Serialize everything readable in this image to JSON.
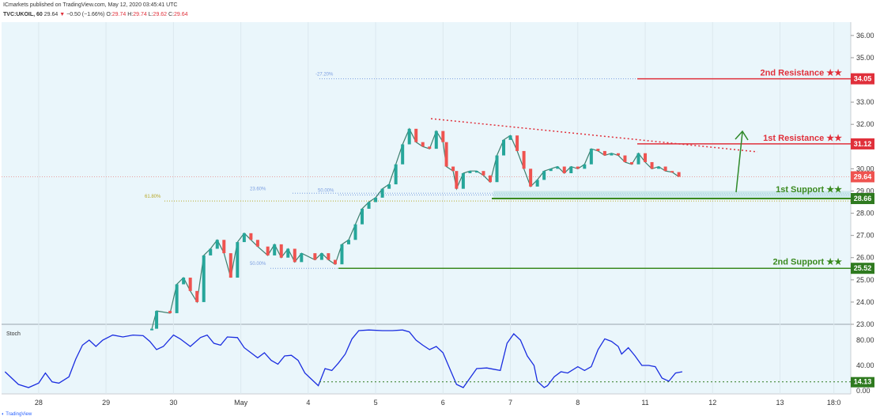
{
  "header": {
    "publisher": "ICmarkets published on TradingView.com, May 12, 2020 03:45:41 UTC",
    "symbol": "TVC:UKOIL, 60",
    "last": "29.64",
    "change": "−0.50 (−1.66%)",
    "ohlc": {
      "O": "29.74",
      "H": "29.74",
      "L": "29.62",
      "C": "29.64"
    }
  },
  "colors": {
    "background": "#eaf6fb",
    "candle_up": "#26a69a",
    "candle_down": "#ef5350",
    "resistance": "#e0303b",
    "support": "#3a8a1f",
    "fib": "#7b9ee0",
    "stoch": "#1a2de0"
  },
  "chart_data": {
    "type": "candlestick",
    "y_axis": {
      "range": [
        23,
        36.6
      ],
      "ticks": [
        "36.00",
        "35.00",
        "34.00",
        "33.00",
        "32.00",
        "31.00",
        "30.00",
        "29.00",
        "28.00",
        "27.00",
        "26.00",
        "25.00",
        "24.00",
        "23.00"
      ]
    },
    "x_axis": {
      "ticks": [
        {
          "label": "28",
          "t": 0.5
        },
        {
          "label": "29",
          "t": 1.5
        },
        {
          "label": "30",
          "t": 2.5
        },
        {
          "label": "May",
          "t": 3.5
        },
        {
          "label": "4",
          "t": 4.5
        },
        {
          "label": "5",
          "t": 5.5
        },
        {
          "label": "6",
          "t": 6.5
        },
        {
          "label": "7",
          "t": 7.5
        },
        {
          "label": "8",
          "t": 8.5
        },
        {
          "label": "11",
          "t": 9.5
        },
        {
          "label": "12",
          "t": 10.5
        },
        {
          "label": "13",
          "t": 11.5
        },
        {
          "label": "18:0",
          "t": 12.3
        }
      ]
    },
    "price_series": [
      [
        2.18,
        22.8
      ],
      [
        2.25,
        23.6
      ],
      [
        2.45,
        23.5
      ],
      [
        2.55,
        24.8
      ],
      [
        2.65,
        25.1
      ],
      [
        2.75,
        24.5
      ],
      [
        2.85,
        24.0
      ],
      [
        2.95,
        26.1
      ],
      [
        3.05,
        26.4
      ],
      [
        3.15,
        26.8
      ],
      [
        3.25,
        26.2
      ],
      [
        3.35,
        25.1
      ],
      [
        3.45,
        26.7
      ],
      [
        3.55,
        27.1
      ],
      [
        3.65,
        26.8
      ],
      [
        3.75,
        26.5
      ],
      [
        3.9,
        26.1
      ],
      [
        4.0,
        26.6
      ],
      [
        4.1,
        26.0
      ],
      [
        4.2,
        26.4
      ],
      [
        4.3,
        25.8
      ],
      [
        4.4,
        26.2
      ],
      [
        4.6,
        25.9
      ],
      [
        4.7,
        26.2
      ],
      [
        4.8,
        25.9
      ],
      [
        4.9,
        25.7
      ],
      [
        5.0,
        26.6
      ],
      [
        5.1,
        26.8
      ],
      [
        5.2,
        27.5
      ],
      [
        5.3,
        28.2
      ],
      [
        5.4,
        28.5
      ],
      [
        5.5,
        28.7
      ],
      [
        5.6,
        29.1
      ],
      [
        5.7,
        29.3
      ],
      [
        5.8,
        30.2
      ],
      [
        5.9,
        31.1
      ],
      [
        6.0,
        31.8
      ],
      [
        6.1,
        31.2
      ],
      [
        6.2,
        31.0
      ],
      [
        6.3,
        30.9
      ],
      [
        6.4,
        31.7
      ],
      [
        6.5,
        31.2
      ],
      [
        6.55,
        30.1
      ],
      [
        6.65,
        29.9
      ],
      [
        6.7,
        29.1
      ],
      [
        6.8,
        29.8
      ],
      [
        6.9,
        29.9
      ],
      [
        7.0,
        29.9
      ],
      [
        7.1,
        29.7
      ],
      [
        7.2,
        29.4
      ],
      [
        7.3,
        30.6
      ],
      [
        7.4,
        31.3
      ],
      [
        7.5,
        31.5
      ],
      [
        7.6,
        30.8
      ],
      [
        7.7,
        30.0
      ],
      [
        7.8,
        29.2
      ],
      [
        7.9,
        29.5
      ],
      [
        8.0,
        29.9
      ],
      [
        8.1,
        30.0
      ],
      [
        8.2,
        30.1
      ],
      [
        8.3,
        29.8
      ],
      [
        8.4,
        30.1
      ],
      [
        8.5,
        30.0
      ],
      [
        8.6,
        30.2
      ],
      [
        8.7,
        30.9
      ],
      [
        8.8,
        30.8
      ],
      [
        8.9,
        30.6
      ],
      [
        9.0,
        30.7
      ],
      [
        9.1,
        30.6
      ],
      [
        9.2,
        30.3
      ],
      [
        9.3,
        30.2
      ],
      [
        9.4,
        30.7
      ],
      [
        9.5,
        30.3
      ],
      [
        9.6,
        30.0
      ],
      [
        9.7,
        30.1
      ],
      [
        9.8,
        29.9
      ],
      [
        9.9,
        29.85
      ],
      [
        10.0,
        29.64
      ]
    ],
    "stoch_axis": {
      "range": [
        0,
        100
      ],
      "ticks": [
        "80.00",
        "40.00",
        "0.00"
      ]
    },
    "stoch_series": [
      [
        0.0,
        30
      ],
      [
        0.2,
        10
      ],
      [
        0.35,
        5
      ],
      [
        0.5,
        12
      ],
      [
        0.6,
        28
      ],
      [
        0.7,
        14
      ],
      [
        0.8,
        12
      ],
      [
        0.95,
        22
      ],
      [
        1.05,
        50
      ],
      [
        1.15,
        72
      ],
      [
        1.25,
        80
      ],
      [
        1.35,
        70
      ],
      [
        1.45,
        80
      ],
      [
        1.6,
        88
      ],
      [
        1.75,
        85
      ],
      [
        1.9,
        88
      ],
      [
        2.05,
        87
      ],
      [
        2.15,
        78
      ],
      [
        2.25,
        65
      ],
      [
        2.35,
        70
      ],
      [
        2.5,
        88
      ],
      [
        2.6,
        82
      ],
      [
        2.75,
        70
      ],
      [
        2.9,
        84
      ],
      [
        3.0,
        88
      ],
      [
        3.1,
        75
      ],
      [
        3.2,
        72
      ],
      [
        3.3,
        85
      ],
      [
        3.45,
        84
      ],
      [
        3.55,
        68
      ],
      [
        3.65,
        60
      ],
      [
        3.75,
        52
      ],
      [
        3.85,
        60
      ],
      [
        3.95,
        48
      ],
      [
        4.05,
        42
      ],
      [
        4.15,
        55
      ],
      [
        4.25,
        56
      ],
      [
        4.35,
        48
      ],
      [
        4.45,
        28
      ],
      [
        4.55,
        18
      ],
      [
        4.65,
        8
      ],
      [
        4.75,
        35
      ],
      [
        4.85,
        32
      ],
      [
        4.95,
        44
      ],
      [
        5.05,
        58
      ],
      [
        5.15,
        82
      ],
      [
        5.25,
        95
      ],
      [
        5.4,
        96
      ],
      [
        5.6,
        95
      ],
      [
        5.75,
        95
      ],
      [
        5.9,
        96
      ],
      [
        6.0,
        93
      ],
      [
        6.1,
        80
      ],
      [
        6.2,
        72
      ],
      [
        6.3,
        65
      ],
      [
        6.4,
        70
      ],
      [
        6.5,
        60
      ],
      [
        6.6,
        35
      ],
      [
        6.7,
        10
      ],
      [
        6.8,
        5
      ],
      [
        6.9,
        20
      ],
      [
        7.0,
        35
      ],
      [
        7.15,
        36
      ],
      [
        7.25,
        34
      ],
      [
        7.35,
        32
      ],
      [
        7.45,
        75
      ],
      [
        7.55,
        90
      ],
      [
        7.65,
        80
      ],
      [
        7.75,
        55
      ],
      [
        7.85,
        40
      ],
      [
        7.9,
        15
      ],
      [
        8.0,
        5
      ],
      [
        8.05,
        8
      ],
      [
        8.15,
        22
      ],
      [
        8.25,
        30
      ],
      [
        8.35,
        28
      ],
      [
        8.5,
        38
      ],
      [
        8.6,
        32
      ],
      [
        8.7,
        38
      ],
      [
        8.8,
        65
      ],
      [
        8.9,
        82
      ],
      [
        9.0,
        78
      ],
      [
        9.1,
        70
      ],
      [
        9.15,
        58
      ],
      [
        9.25,
        68
      ],
      [
        9.35,
        55
      ],
      [
        9.45,
        40
      ],
      [
        9.55,
        40
      ],
      [
        9.65,
        38
      ],
      [
        9.75,
        20
      ],
      [
        9.85,
        15
      ],
      [
        9.95,
        28
      ],
      [
        10.05,
        30
      ]
    ],
    "levels": {
      "resistance_2": {
        "label": "2nd Resistance ★★",
        "value": "34.05"
      },
      "resistance_1": {
        "label": "1st Resistance ★★",
        "value": "31.12"
      },
      "current": {
        "value": "29.64"
      },
      "support_1": {
        "label": "1st Support ★★",
        "value": "28.66"
      },
      "support_2": {
        "label": "2nd Support ★★",
        "value": "25.52"
      },
      "stoch_level": {
        "value": "14.13"
      }
    },
    "fib_labels": {
      "f1": "-27.20%",
      "f2": "23.60%",
      "f3": "50.00%",
      "f4": "61.80%",
      "f5": "50.00%"
    },
    "stoch_title": "Stoch"
  },
  "footer": {
    "logo": "TradingView"
  }
}
